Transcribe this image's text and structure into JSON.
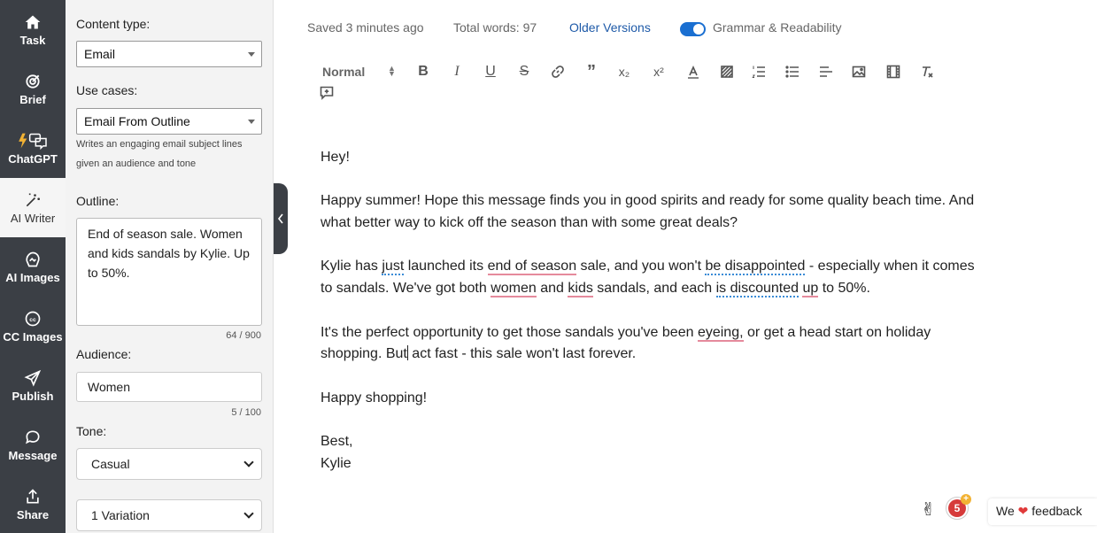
{
  "rail": [
    {
      "label": "Task",
      "icon": "home-icon",
      "active": false
    },
    {
      "label": "Brief",
      "icon": "target-icon",
      "active": false
    },
    {
      "label": "ChatGPT",
      "icon": "chat-bolt-icon",
      "active": false
    },
    {
      "label": "AI Writer",
      "icon": "magic-wand-icon",
      "active": true
    },
    {
      "label": "AI Images",
      "icon": "image-brain-icon",
      "active": false
    },
    {
      "label": "CC Images",
      "icon": "creative-commons-icon",
      "active": false
    },
    {
      "label": "Publish",
      "icon": "paper-plane-icon",
      "active": false
    },
    {
      "label": "Message",
      "icon": "speech-bubble-icon",
      "active": false
    },
    {
      "label": "Share",
      "icon": "share-icon",
      "active": false
    }
  ],
  "panel": {
    "content_type_label": "Content type:",
    "content_type_value": "Email",
    "use_cases_label": "Use cases:",
    "use_case_value": "Email From Outline",
    "use_case_help": "Writes an engaging email subject lines given an audience and tone",
    "outline_label": "Outline:",
    "outline_value": "End of season sale. Women and kids sandals by Kylie. Up to 50%.",
    "outline_counter": "64 / 900",
    "audience_label": "Audience:",
    "audience_value": "Women",
    "audience_counter": "5 / 100",
    "tone_label": "Tone:",
    "tone_value": "Casual",
    "variation_value": "1 Variation"
  },
  "status": {
    "saved": "Saved 3 minutes ago",
    "words": "Total words: 97",
    "older_versions": "Older Versions",
    "grammar": "Grammar & Readability",
    "grammar_on": true
  },
  "toolbar": {
    "format": "Normal",
    "subscript": "x₂",
    "superscript": "x²"
  },
  "editor": {
    "greeting": "Hey!",
    "p1": "Happy summer! Hope this message finds you in good spirits and ready for some quality beach time. And what better way to kick off the season than with some great deals?",
    "p2_a": "Kylie has ",
    "p2_just": "just",
    "p2_b": " launched its ",
    "p2_eos": "end of season",
    "p2_c": " sale, and you won't ",
    "p2_bd": "be disappointed",
    "p2_d": " - especially when it comes to sandals. We've got both ",
    "p2_women": "women",
    "p2_e": " and ",
    "p2_kids": "kids",
    "p2_f": " sandals, and each ",
    "p2_isd": "is discounted",
    "p2_g": " ",
    "p2_up": "up",
    "p2_h": " to 50%.",
    "p3_a": "It's the perfect opportunity to get those sandals you've been ",
    "p3_eyeing": "eyeing,",
    "p3_b": " or get a head start on holiday shopping. But",
    "p3_c": " act fast - this sale won't last forever.",
    "closing": "Happy shopping!",
    "signoff": "Best,",
    "signature": "Kylie"
  },
  "bottom": {
    "badge_count": "5",
    "badge_plus": "+",
    "feedback_pre": "We",
    "heart": "❤",
    "feedback_post": "feedback"
  },
  "colors": {
    "rail_bg": "#3b3f45",
    "accent_blue": "#1a6fd1",
    "spell_red": "#e58a9c",
    "grammar_blue": "#3a8bd6"
  }
}
